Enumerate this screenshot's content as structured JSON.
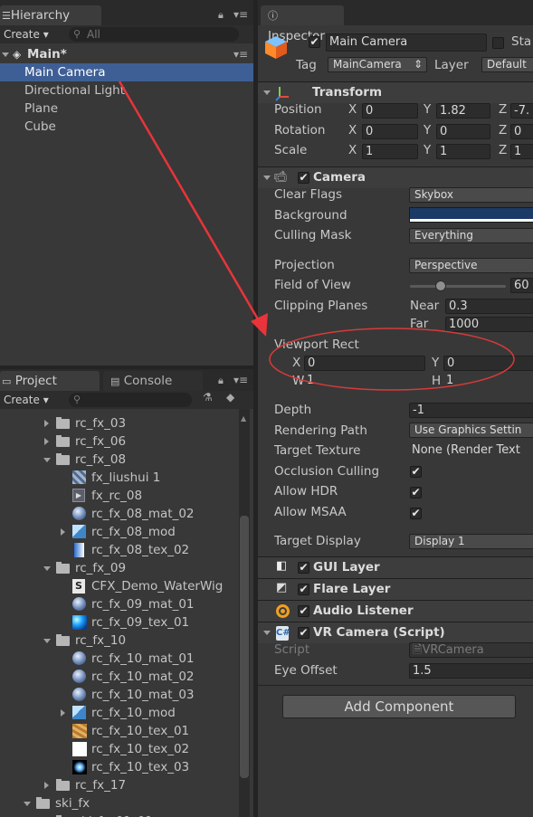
{
  "hierarchy": {
    "tab": "Hierarchy",
    "create": "Create",
    "search_placeholder": "All",
    "scene": "Main*",
    "items": [
      "Main Camera",
      "Directional Light",
      "Plane",
      "Cube"
    ]
  },
  "project": {
    "tab": "Project",
    "console_tab": "Console",
    "create": "Create",
    "tree": [
      {
        "label": "rc_fx_03",
        "level": 1,
        "icon": "folder-icon",
        "expand": "collapsed"
      },
      {
        "label": "rc_fx_06",
        "level": 1,
        "icon": "folder-icon",
        "expand": "collapsed"
      },
      {
        "label": "rc_fx_08",
        "level": 1,
        "icon": "folder-icon",
        "expand": "expanded"
      },
      {
        "label": "fx_liushui 1",
        "level": 2,
        "icon": "texture-tile-icon",
        "expand": "none"
      },
      {
        "label": "fx_rc_08",
        "level": 2,
        "icon": "animation-icon",
        "expand": "none"
      },
      {
        "label": "rc_fx_08_mat_02",
        "level": 2,
        "icon": "material-sphere-icon",
        "expand": "none"
      },
      {
        "label": "rc_fx_08_mod",
        "level": 2,
        "icon": "model-icon",
        "expand": "collapsed"
      },
      {
        "label": "rc_fx_08_tex_02",
        "level": 2,
        "icon": "texture-icon",
        "expand": "none"
      },
      {
        "label": "rc_fx_09",
        "level": 1,
        "icon": "folder-icon",
        "expand": "expanded"
      },
      {
        "label": "CFX_Demo_WaterWig",
        "level": 2,
        "icon": "script-icon",
        "expand": "none"
      },
      {
        "label": "rc_fx_09_mat_01",
        "level": 2,
        "icon": "material-sphere-icon",
        "expand": "none"
      },
      {
        "label": "rc_fx_09_tex_01",
        "level": 2,
        "icon": "texture-blue-icon",
        "expand": "none"
      },
      {
        "label": "rc_fx_10",
        "level": 1,
        "icon": "folder-icon",
        "expand": "expanded"
      },
      {
        "label": "rc_fx_10_mat_01",
        "level": 2,
        "icon": "material-sphere-icon",
        "expand": "none"
      },
      {
        "label": "rc_fx_10_mat_02",
        "level": 2,
        "icon": "material-sphere-icon",
        "expand": "none"
      },
      {
        "label": "rc_fx_10_mat_03",
        "level": 2,
        "icon": "material-sphere-icon",
        "expand": "none"
      },
      {
        "label": "rc_fx_10_mod",
        "level": 2,
        "icon": "model-icon",
        "expand": "collapsed"
      },
      {
        "label": "rc_fx_10_tex_01",
        "level": 2,
        "icon": "texture-brown-icon",
        "expand": "none"
      },
      {
        "label": "rc_fx_10_tex_02",
        "level": 2,
        "icon": "texture-white-icon",
        "expand": "none"
      },
      {
        "label": "rc_fx_10_tex_03",
        "level": 2,
        "icon": "texture-glow-icon",
        "expand": "none"
      },
      {
        "label": "rc_fx_17",
        "level": 1,
        "icon": "folder-icon",
        "expand": "collapsed"
      },
      {
        "label": "ski_fx",
        "level": 0,
        "icon": "folder-icon",
        "expand": "expanded"
      },
      {
        "label": "ski_fx_01_01",
        "level": 1,
        "icon": "folder-icon",
        "expand": "collapsed"
      }
    ]
  },
  "inspector": {
    "tab": "Inspector",
    "object_name": "Main Camera",
    "static_label": "Sta",
    "tag_label": "Tag",
    "tag_value": "MainCamera",
    "layer_label": "Layer",
    "layer_value": "Default",
    "transform": {
      "title": "Transform",
      "position_label": "Position",
      "rotation_label": "Rotation",
      "scale_label": "Scale",
      "x": "X",
      "y": "Y",
      "z": "Z",
      "pos": [
        "0",
        "1.82",
        "-7."
      ],
      "rot": [
        "0",
        "0",
        "0"
      ],
      "scale": [
        "1",
        "1",
        "1"
      ]
    },
    "camera": {
      "title": "Camera",
      "clear_flags_label": "Clear Flags",
      "clear_flags": "Skybox",
      "background_label": "Background",
      "culling_mask_label": "Culling Mask",
      "culling_mask": "Everything",
      "projection_label": "Projection",
      "projection": "Perspective",
      "fov_label": "Field of View",
      "fov": "60",
      "clipping_label": "Clipping Planes",
      "near_label": "Near",
      "near": "0.3",
      "far_label": "Far",
      "far": "1000",
      "viewport_label": "Viewport Rect",
      "vx_label": "X",
      "vx": "0",
      "vy_label": "Y",
      "vy": "0",
      "vw_label": "W",
      "vw": "1",
      "vh_label": "H",
      "vh": "1",
      "depth_label": "Depth",
      "depth": "-1",
      "rendering_path_label": "Rendering Path",
      "rendering_path": "Use Graphics Settin",
      "target_texture_label": "Target Texture",
      "target_texture": "None (Render Text",
      "occlusion_label": "Occlusion Culling",
      "hdr_label": "Allow HDR",
      "msaa_label": "Allow MSAA",
      "target_display_label": "Target Display",
      "target_display": "Display 1"
    },
    "gui_layer": "GUI Layer",
    "flare_layer": "Flare Layer",
    "audio_listener": "Audio Listener",
    "vr_camera": {
      "title": "VR Camera (Script)",
      "script_label": "Script",
      "script_value": "VRCamera",
      "eye_offset_label": "Eye Offset",
      "eye_offset": "1.5"
    },
    "add_component": "Add Component"
  },
  "colors": {
    "selection": "#3e5f96",
    "annotation": "#e8343a",
    "background_swatch": "#1c3a66"
  }
}
